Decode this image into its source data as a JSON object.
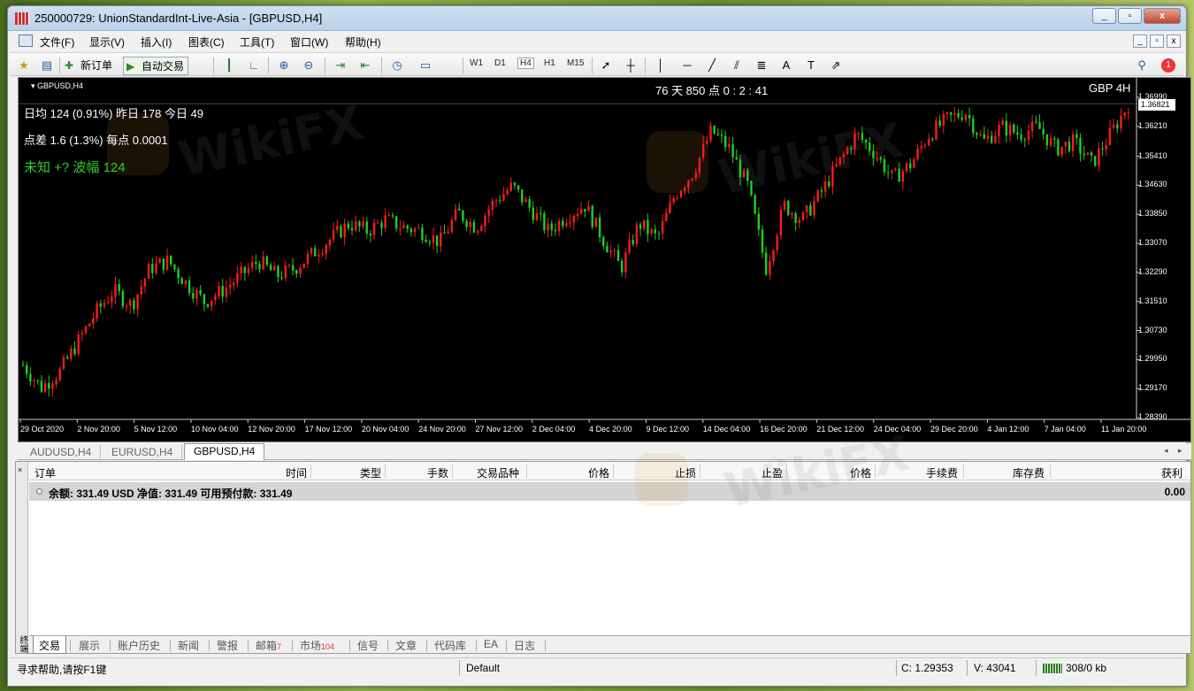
{
  "window": {
    "title": "250000729: UnionStandardInt-Live-Asia - [GBPUSD,H4]",
    "controls": [
      "_",
      "▫",
      "x"
    ]
  },
  "menu": {
    "items": [
      "文件(F)",
      "显示(V)",
      "插入(I)",
      "图表(C)",
      "工具(T)",
      "窗口(W)",
      "帮助(H)"
    ]
  },
  "toolbar": {
    "new_order": "新订单",
    "auto_trading": "自动交易",
    "timeframes": [
      "W1",
      "D1",
      "H4",
      "H1",
      "M15"
    ],
    "active_timeframe": "H4",
    "notification_count": "1"
  },
  "chart": {
    "symbol_label": "GBPUSD,H4",
    "countdown": "76 天   850 点    0 : 2 : 41",
    "corner_label": "GBP 4H",
    "info_line1": "日均   124 (0.91%)   昨日   178   今日   49",
    "info_line2": "点差   1.6 (1.3%)    每点   0.0001",
    "info_line3": "未知    +?   波幅 124",
    "current_price": "1.36821",
    "watermark": "WikiFX"
  },
  "chart_data": {
    "type": "candlestick",
    "title": "GBPUSD,H4",
    "price_axis": [
      "1.36990",
      "1.36210",
      "1.35410",
      "1.34630",
      "1.33850",
      "1.33070",
      "1.32290",
      "1.31510",
      "1.30730",
      "1.29950",
      "1.29170",
      "1.28390"
    ],
    "date_axis": [
      "29 Oct 2020",
      "2 Nov 20:00",
      "5 Nov 12:00",
      "10 Nov 04:00",
      "12 Nov 20:00",
      "17 Nov 12:00",
      "20 Nov 04:00",
      "24 Nov 20:00",
      "27 Nov 12:00",
      "2 Dec 04:00",
      "4 Dec 20:00",
      "9 Dec 12:00",
      "14 Dec 04:00",
      "16 Dec 20:00",
      "21 Dec 12:00",
      "24 Dec 04:00",
      "29 Dec 20:00",
      "4 Jan 12:00",
      "7 Jan 04:00",
      "11 Jan 20:00"
    ],
    "ylim": [
      1.2839,
      1.3699
    ],
    "trend_closes": [
      1.298,
      1.292,
      1.296,
      1.304,
      1.312,
      1.318,
      1.314,
      1.324,
      1.326,
      1.32,
      1.315,
      1.318,
      1.322,
      1.326,
      1.322,
      1.324,
      1.328,
      1.332,
      1.336,
      1.334,
      1.337,
      1.335,
      1.334,
      1.331,
      1.339,
      1.335,
      1.342,
      1.346,
      1.34,
      1.334,
      1.338,
      1.341,
      1.332,
      1.324,
      1.336,
      1.332,
      1.344,
      1.35,
      1.361,
      1.356,
      1.346,
      1.324,
      1.341,
      1.337,
      1.344,
      1.352,
      1.36,
      1.355,
      1.348,
      1.352,
      1.36,
      1.364,
      1.366,
      1.358,
      1.362,
      1.36,
      1.362,
      1.356,
      1.358,
      1.352,
      1.36,
      1.368
    ],
    "bull_color": "#ff1a1a",
    "bear_color": "#1fd01f"
  },
  "chart_tabs": [
    "AUDUSD,H4",
    "EURUSD,H4",
    "GBPUSD,H4"
  ],
  "terminal": {
    "columns": [
      "订单",
      "时间",
      "类型",
      "手数",
      "交易品种",
      "价格",
      "止损",
      "止盈",
      "价格",
      "手续费",
      "库存费",
      "获利"
    ],
    "balance_text": "余额: 331.49 USD  净值: 331.49   可用预付款: 331.49",
    "profit": "0.00",
    "tabs": [
      {
        "label": "交易",
        "badge": ""
      },
      {
        "label": "展示",
        "badge": ""
      },
      {
        "label": "账户历史",
        "badge": ""
      },
      {
        "label": "新闻",
        "badge": ""
      },
      {
        "label": "警报",
        "badge": ""
      },
      {
        "label": "邮箱",
        "badge": "7"
      },
      {
        "label": "市场",
        "badge": "104"
      },
      {
        "label": "信号",
        "badge": ""
      },
      {
        "label": "文章",
        "badge": ""
      },
      {
        "label": "代码库",
        "badge": ""
      },
      {
        "label": "EA",
        "badge": ""
      },
      {
        "label": "日志",
        "badge": ""
      }
    ],
    "side_label": "终端"
  },
  "status": {
    "help": "寻求帮助,请按F1键",
    "profile": "Default",
    "close": "C: 1.29353",
    "volume": "V: 43041",
    "traffic": "308/0 kb"
  }
}
